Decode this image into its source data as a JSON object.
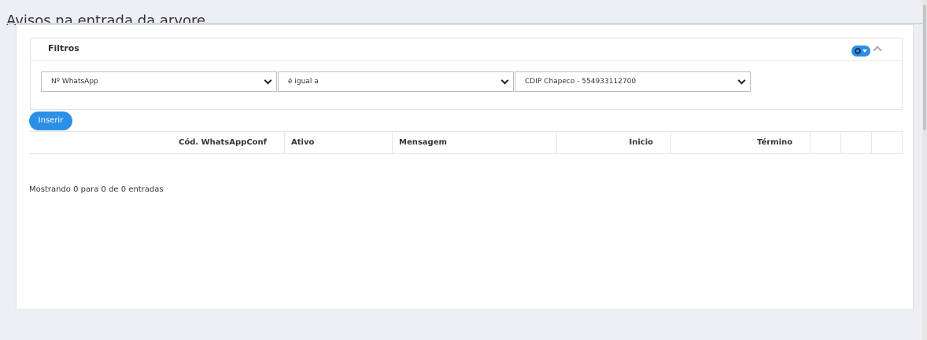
{
  "page": {
    "title": "Avisos na entrada da arvore"
  },
  "filters": {
    "title": "Filtros",
    "field_value": "Nº WhatsApp",
    "operator_value": "é igual a",
    "value_value": "CDIP Chapeco - 554933112700",
    "toggle_icon": "gear-icon",
    "collapse_icon": "chevron-up-icon"
  },
  "actions": {
    "insert_label": "Inserir"
  },
  "table": {
    "columns": [
      "Cód. WhatsAppConf",
      "Ativo",
      "Mensagem",
      "Inicio",
      "Término",
      "",
      "",
      ""
    ]
  },
  "footer": {
    "info": "Mostrando 0 para 0 de 0 entradas"
  },
  "colors": {
    "accent": "#2b8fe8",
    "background": "#eceff3"
  }
}
